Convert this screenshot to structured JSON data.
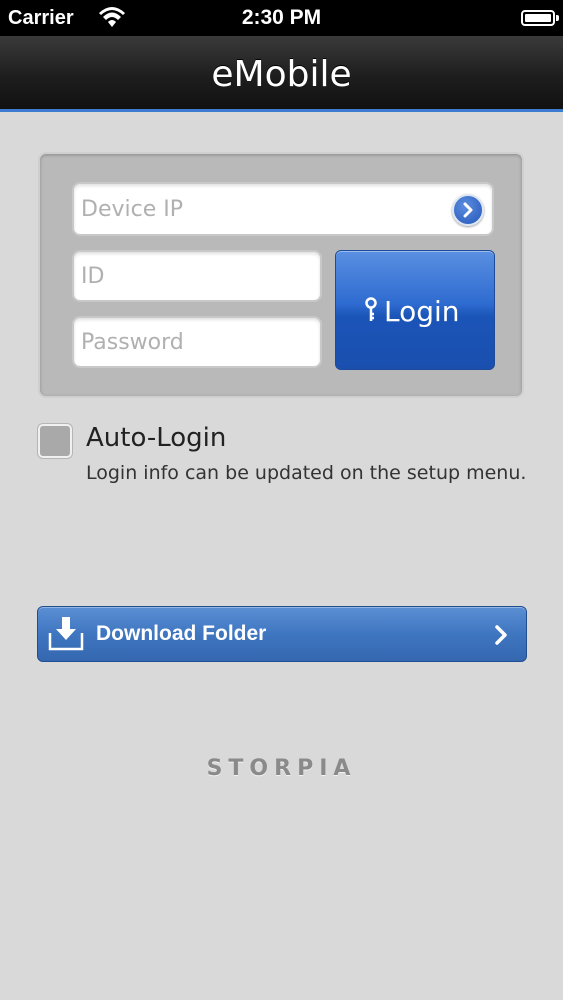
{
  "status_bar": {
    "carrier": "Carrier",
    "time": "2:30 PM",
    "wifi_icon": "wifi-icon",
    "battery_icon": "battery-icon"
  },
  "nav": {
    "title": "eMobile"
  },
  "login": {
    "device_ip_placeholder": "Device IP",
    "device_ip_value": "",
    "id_placeholder": "ID",
    "id_value": "",
    "password_placeholder": "Password",
    "password_value": "",
    "login_label": "Login",
    "login_icon": "key-icon",
    "ip_action_icon": "chevron-right-circle-icon"
  },
  "auto_login": {
    "label": "Auto-Login",
    "checked": false,
    "help_text": "Login info can be updated on the setup menu."
  },
  "download_folder": {
    "label": "Download Folder",
    "icon": "download-tray-icon",
    "chevron_icon": "chevron-right-icon"
  },
  "brand": {
    "logo_text": "STORPIA"
  },
  "colors": {
    "accent_blue": "#2e6bd0",
    "nav_underline": "#3b7bd0",
    "background": "#d9d9d9"
  }
}
